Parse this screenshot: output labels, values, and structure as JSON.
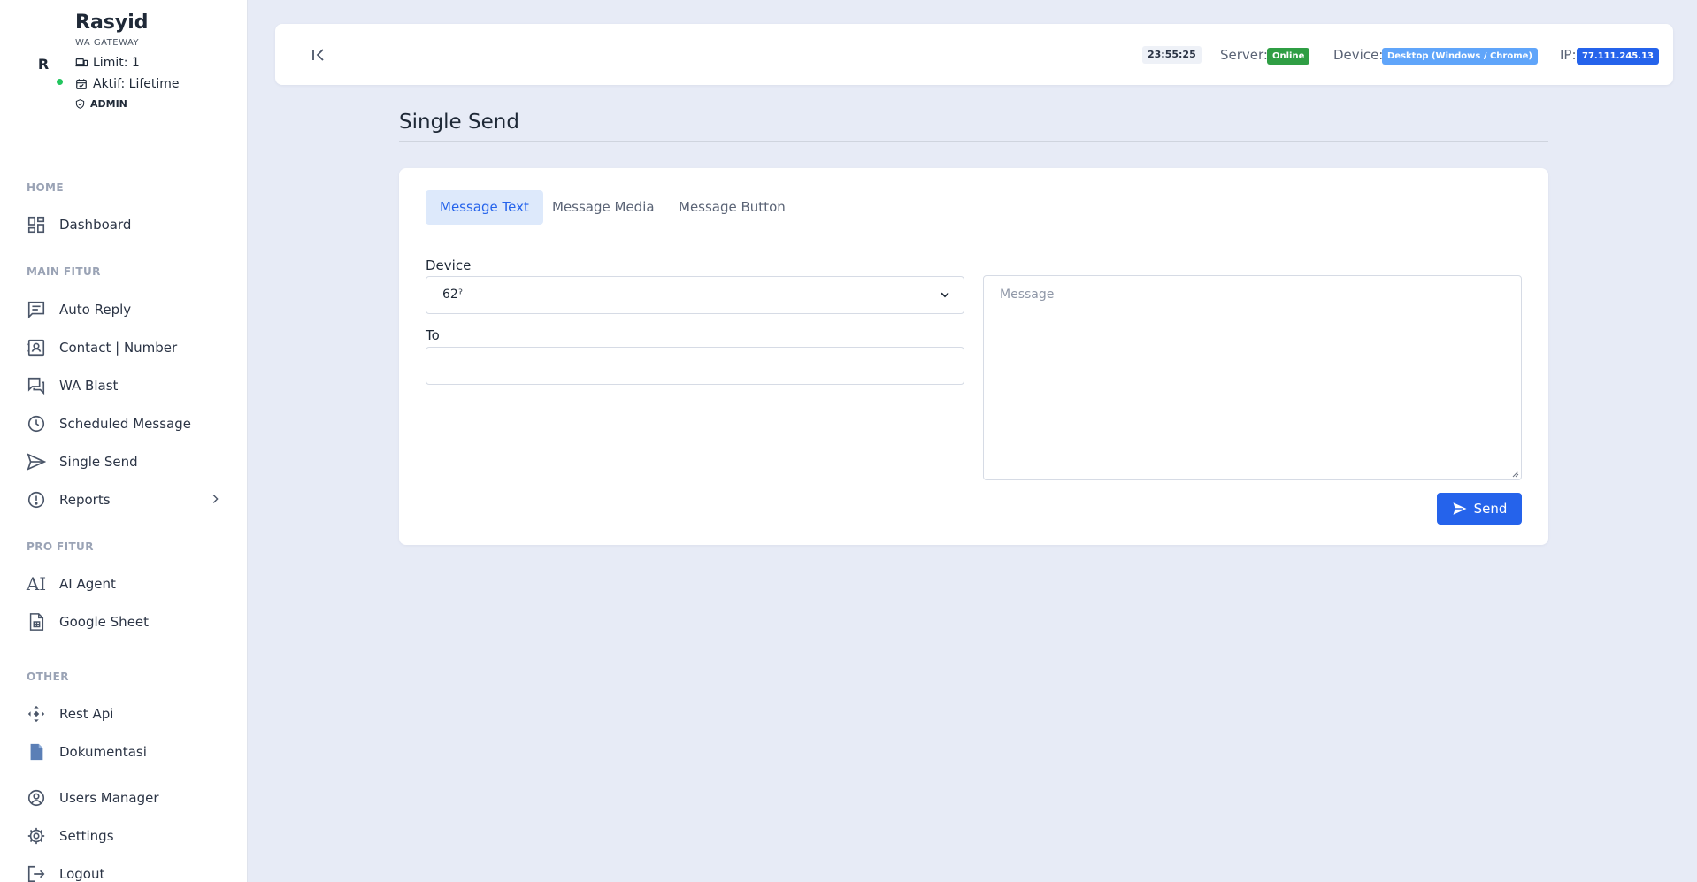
{
  "profile": {
    "avatar_initial": "R",
    "name": "Rasyid",
    "subtitle": "WA GATEWAY",
    "limit": "Limit: 1",
    "active": "Aktif: Lifetime",
    "role": "ADMIN"
  },
  "sidebar": {
    "sections": {
      "home": "HOME",
      "main": "MAIN FITUR",
      "pro": "PRO FITUR",
      "other": "OTHER"
    },
    "items": {
      "dashboard": "Dashboard",
      "auto_reply": "Auto Reply",
      "contact": "Contact | Number",
      "wa_blast": "WA Blast",
      "scheduled": "Scheduled Message",
      "single_send": "Single Send",
      "reports": "Reports",
      "ai_agent": "AI Agent",
      "ai_icon_text": "AI",
      "google_sheet": "Google Sheet",
      "rest_api": "Rest Api",
      "dokumentasi": "Dokumentasi",
      "users_manager": "Users Manager",
      "settings": "Settings",
      "logout": "Logout"
    }
  },
  "topbar": {
    "clock": "23:55:25",
    "server_label": "Server:",
    "server_status": "Online",
    "device_label": "Device:",
    "device_value": "Desktop (Windows / Chrome)",
    "ip_label": "IP:",
    "ip_value": "77.111.245.13"
  },
  "page": {
    "title": "Single Send"
  },
  "form": {
    "tabs": [
      "Message Text",
      "Message Media",
      "Message Button"
    ],
    "device_label": "Device",
    "device_value": "62ˀ",
    "to_label": "To",
    "to_value": "",
    "message_placeholder": "Message",
    "send_label": "Send"
  },
  "colors": {
    "accent": "#2563eb",
    "online_badge": "#2f9e44",
    "device_badge": "#60a5fa",
    "ip_badge": "#2563eb",
    "online_dot": "#22c55e"
  }
}
